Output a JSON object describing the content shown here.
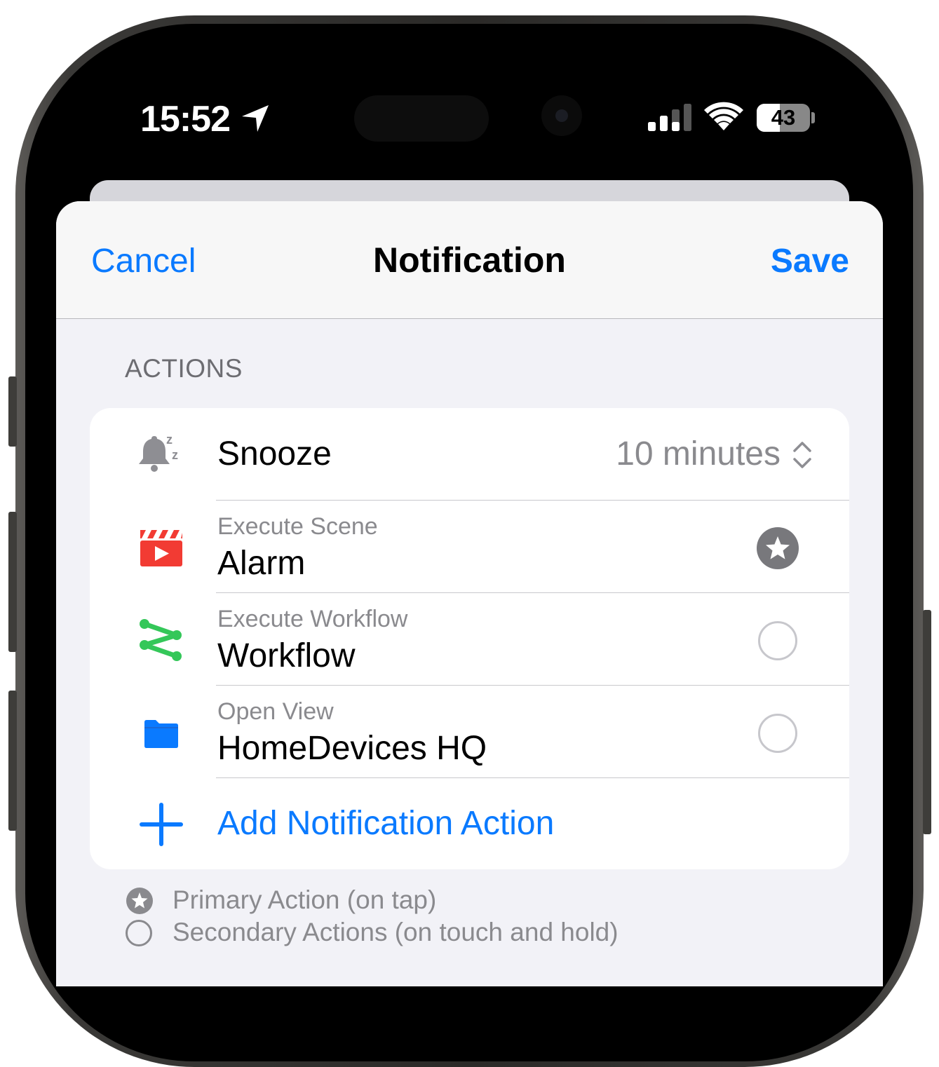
{
  "status_bar": {
    "time": "15:52",
    "battery_level": "43",
    "battery_fraction": 0.43,
    "location_icon": "location-arrow-icon",
    "signal_icon": "cellular-signal-icon",
    "wifi_icon": "wifi-icon"
  },
  "nav": {
    "cancel": "Cancel",
    "title": "Notification",
    "save": "Save"
  },
  "section": {
    "header": "ACTIONS"
  },
  "actions": [
    {
      "icon": "bell-snooze-icon",
      "title": "Snooze",
      "value": "10 minutes",
      "value_icon": "up-down-chevron-icon"
    },
    {
      "icon": "clapperboard-icon",
      "subtitle": "Execute Scene",
      "title": "Alarm",
      "selection": "primary"
    },
    {
      "icon": "workflow-icon",
      "subtitle": "Execute Workflow",
      "title": "Workflow",
      "selection": "none"
    },
    {
      "icon": "folder-icon",
      "subtitle": "Open View",
      "title": "HomeDevices HQ",
      "selection": "none"
    }
  ],
  "add_action": {
    "label": "Add Notification Action",
    "icon": "plus-icon"
  },
  "legend": {
    "primary": "Primary Action (on tap)",
    "secondary": "Secondary Actions (on touch and hold)"
  },
  "colors": {
    "accent": "#0A7AFF",
    "scene_red": "#F23B33",
    "workflow_green": "#34C759",
    "folder_blue": "#0A7AFF",
    "secondary_text": "#8A8A8E"
  }
}
